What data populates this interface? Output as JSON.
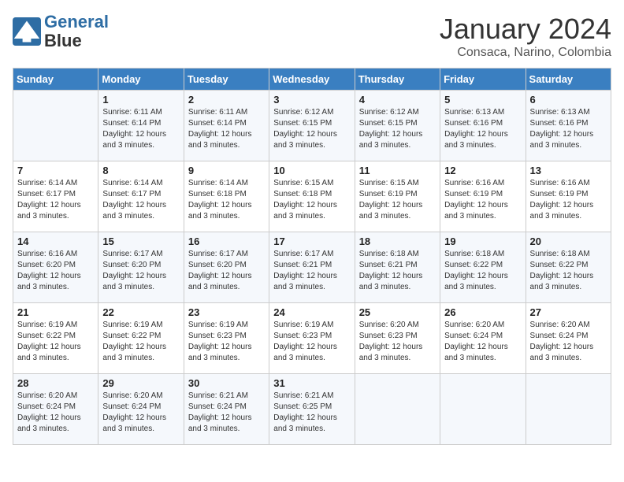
{
  "header": {
    "logo_line1": "General",
    "logo_line2": "Blue",
    "month_title": "January 2024",
    "subtitle": "Consaca, Narino, Colombia"
  },
  "days_of_week": [
    "Sunday",
    "Monday",
    "Tuesday",
    "Wednesday",
    "Thursday",
    "Friday",
    "Saturday"
  ],
  "weeks": [
    [
      {
        "day": "",
        "info": ""
      },
      {
        "day": "1",
        "info": "Sunrise: 6:11 AM\nSunset: 6:14 PM\nDaylight: 12 hours\nand 3 minutes."
      },
      {
        "day": "2",
        "info": "Sunrise: 6:11 AM\nSunset: 6:14 PM\nDaylight: 12 hours\nand 3 minutes."
      },
      {
        "day": "3",
        "info": "Sunrise: 6:12 AM\nSunset: 6:15 PM\nDaylight: 12 hours\nand 3 minutes."
      },
      {
        "day": "4",
        "info": "Sunrise: 6:12 AM\nSunset: 6:15 PM\nDaylight: 12 hours\nand 3 minutes."
      },
      {
        "day": "5",
        "info": "Sunrise: 6:13 AM\nSunset: 6:16 PM\nDaylight: 12 hours\nand 3 minutes."
      },
      {
        "day": "6",
        "info": "Sunrise: 6:13 AM\nSunset: 6:16 PM\nDaylight: 12 hours\nand 3 minutes."
      }
    ],
    [
      {
        "day": "7",
        "info": "Sunrise: 6:14 AM\nSunset: 6:17 PM\nDaylight: 12 hours\nand 3 minutes."
      },
      {
        "day": "8",
        "info": "Sunrise: 6:14 AM\nSunset: 6:17 PM\nDaylight: 12 hours\nand 3 minutes."
      },
      {
        "day": "9",
        "info": "Sunrise: 6:14 AM\nSunset: 6:18 PM\nDaylight: 12 hours\nand 3 minutes."
      },
      {
        "day": "10",
        "info": "Sunrise: 6:15 AM\nSunset: 6:18 PM\nDaylight: 12 hours\nand 3 minutes."
      },
      {
        "day": "11",
        "info": "Sunrise: 6:15 AM\nSunset: 6:19 PM\nDaylight: 12 hours\nand 3 minutes."
      },
      {
        "day": "12",
        "info": "Sunrise: 6:16 AM\nSunset: 6:19 PM\nDaylight: 12 hours\nand 3 minutes."
      },
      {
        "day": "13",
        "info": "Sunrise: 6:16 AM\nSunset: 6:19 PM\nDaylight: 12 hours\nand 3 minutes."
      }
    ],
    [
      {
        "day": "14",
        "info": "Sunrise: 6:16 AM\nSunset: 6:20 PM\nDaylight: 12 hours\nand 3 minutes."
      },
      {
        "day": "15",
        "info": "Sunrise: 6:17 AM\nSunset: 6:20 PM\nDaylight: 12 hours\nand 3 minutes."
      },
      {
        "day": "16",
        "info": "Sunrise: 6:17 AM\nSunset: 6:20 PM\nDaylight: 12 hours\nand 3 minutes."
      },
      {
        "day": "17",
        "info": "Sunrise: 6:17 AM\nSunset: 6:21 PM\nDaylight: 12 hours\nand 3 minutes."
      },
      {
        "day": "18",
        "info": "Sunrise: 6:18 AM\nSunset: 6:21 PM\nDaylight: 12 hours\nand 3 minutes."
      },
      {
        "day": "19",
        "info": "Sunrise: 6:18 AM\nSunset: 6:22 PM\nDaylight: 12 hours\nand 3 minutes."
      },
      {
        "day": "20",
        "info": "Sunrise: 6:18 AM\nSunset: 6:22 PM\nDaylight: 12 hours\nand 3 minutes."
      }
    ],
    [
      {
        "day": "21",
        "info": "Sunrise: 6:19 AM\nSunset: 6:22 PM\nDaylight: 12 hours\nand 3 minutes."
      },
      {
        "day": "22",
        "info": "Sunrise: 6:19 AM\nSunset: 6:22 PM\nDaylight: 12 hours\nand 3 minutes."
      },
      {
        "day": "23",
        "info": "Sunrise: 6:19 AM\nSunset: 6:23 PM\nDaylight: 12 hours\nand 3 minutes."
      },
      {
        "day": "24",
        "info": "Sunrise: 6:19 AM\nSunset: 6:23 PM\nDaylight: 12 hours\nand 3 minutes."
      },
      {
        "day": "25",
        "info": "Sunrise: 6:20 AM\nSunset: 6:23 PM\nDaylight: 12 hours\nand 3 minutes."
      },
      {
        "day": "26",
        "info": "Sunrise: 6:20 AM\nSunset: 6:24 PM\nDaylight: 12 hours\nand 3 minutes."
      },
      {
        "day": "27",
        "info": "Sunrise: 6:20 AM\nSunset: 6:24 PM\nDaylight: 12 hours\nand 3 minutes."
      }
    ],
    [
      {
        "day": "28",
        "info": "Sunrise: 6:20 AM\nSunset: 6:24 PM\nDaylight: 12 hours\nand 3 minutes."
      },
      {
        "day": "29",
        "info": "Sunrise: 6:20 AM\nSunset: 6:24 PM\nDaylight: 12 hours\nand 3 minutes."
      },
      {
        "day": "30",
        "info": "Sunrise: 6:21 AM\nSunset: 6:24 PM\nDaylight: 12 hours\nand 3 minutes."
      },
      {
        "day": "31",
        "info": "Sunrise: 6:21 AM\nSunset: 6:25 PM\nDaylight: 12 hours\nand 3 minutes."
      },
      {
        "day": "",
        "info": ""
      },
      {
        "day": "",
        "info": ""
      },
      {
        "day": "",
        "info": ""
      }
    ]
  ]
}
